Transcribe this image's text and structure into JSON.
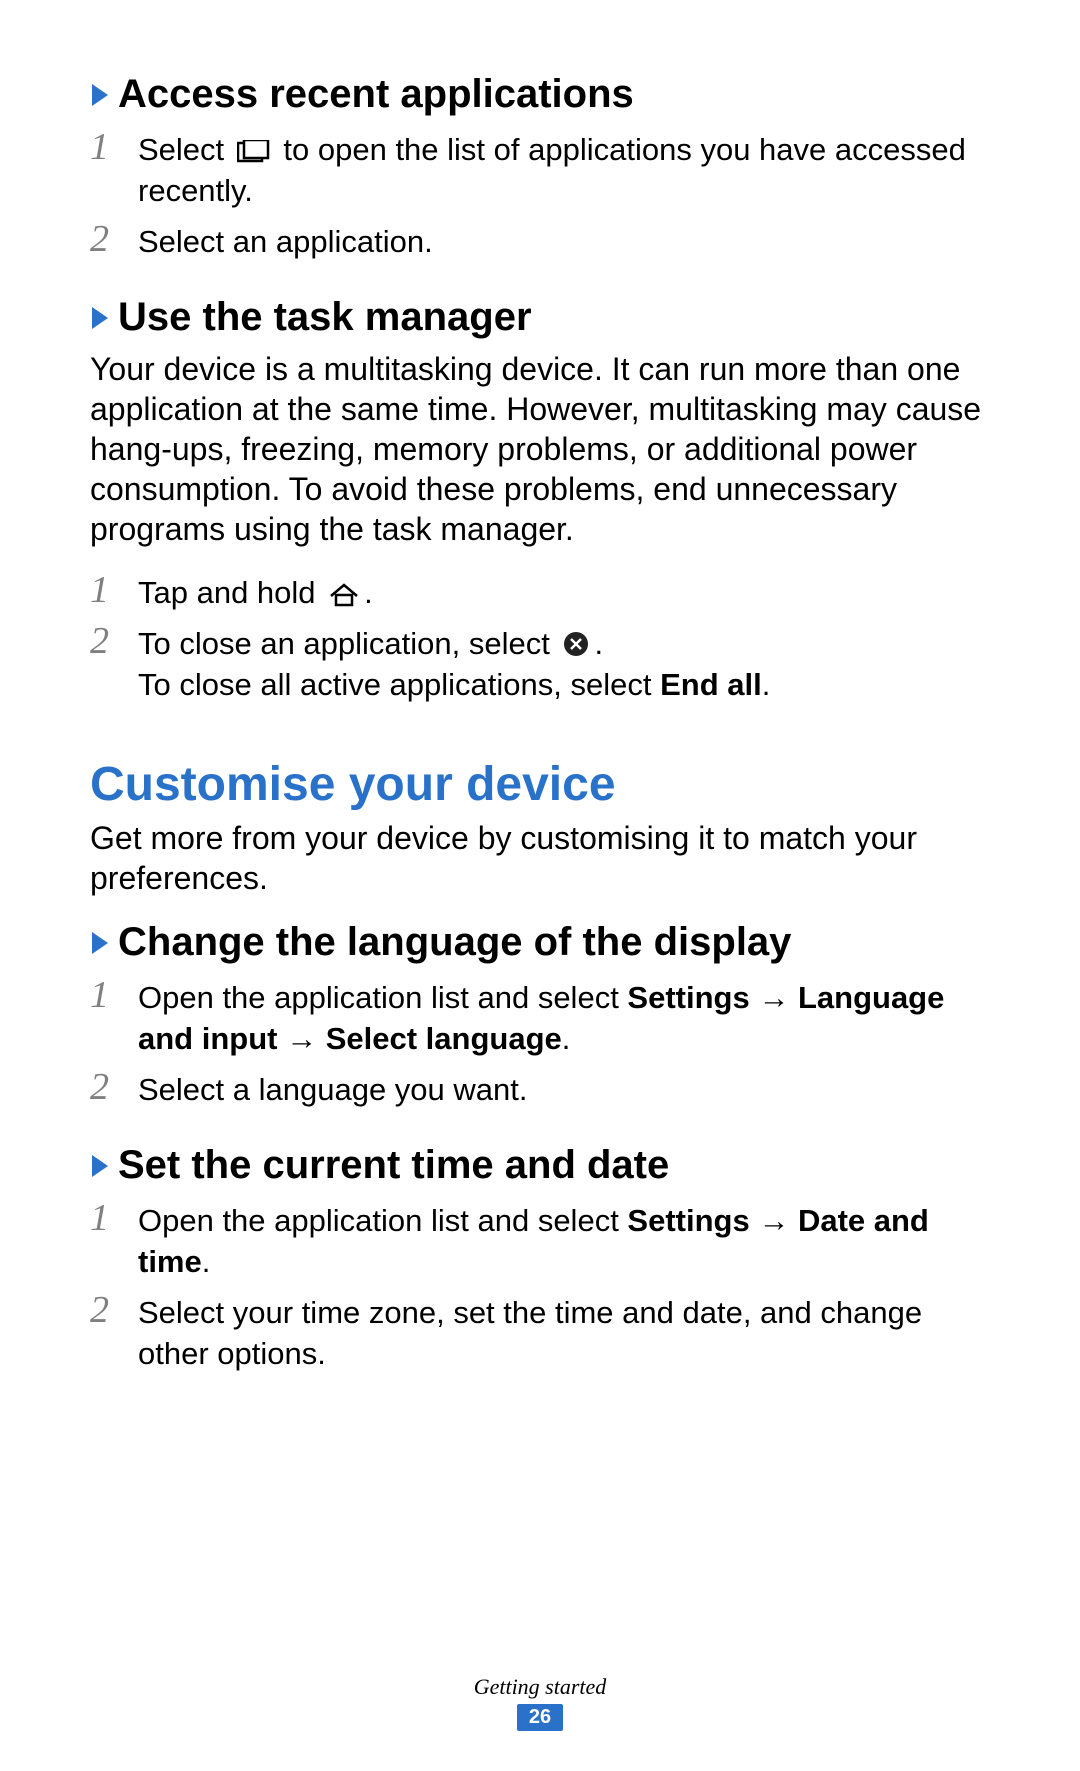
{
  "sections": {
    "recent": {
      "heading": "Access recent applications",
      "steps": [
        {
          "num": "1",
          "pre": "Select ",
          "post": " to open the list of applications you have accessed recently."
        },
        {
          "num": "2",
          "text": "Select an application."
        }
      ]
    },
    "taskmgr": {
      "heading": "Use the task manager",
      "intro": "Your device is a multitasking device. It can run more than one application at the same time. However, multitasking may cause hang-ups, freezing, memory problems, or additional power consumption. To avoid these problems, end unnecessary programs using the task manager.",
      "steps": [
        {
          "num": "1",
          "pre": "Tap and hold ",
          "post": "."
        },
        {
          "num": "2",
          "pre": "To close an application, select ",
          "post": ".",
          "cont_pre": "To close all active applications, select ",
          "cont_bold": "End all",
          "cont_post": "."
        }
      ]
    },
    "customise": {
      "heading": "Customise your device",
      "intro": "Get more from your device by customising it to match your preferences."
    },
    "language": {
      "heading": "Change the language of the display",
      "steps": [
        {
          "num": "1",
          "pre": "Open the application list and select ",
          "b1": "Settings",
          "arrow1": " → ",
          "b2": "Language and input",
          "arrow2": " → ",
          "b3": "Select language",
          "post": "."
        },
        {
          "num": "2",
          "text": "Select a language you want."
        }
      ]
    },
    "datetime": {
      "heading": "Set the current time and date",
      "steps": [
        {
          "num": "1",
          "pre": "Open the application list and select ",
          "b1": "Settings",
          "arrow1": " → ",
          "b2": "Date and time",
          "post": "."
        },
        {
          "num": "2",
          "text": "Select your time zone, set the time and date, and change other options."
        }
      ]
    }
  },
  "footer": {
    "section_title": "Getting started",
    "page_no": "26"
  }
}
